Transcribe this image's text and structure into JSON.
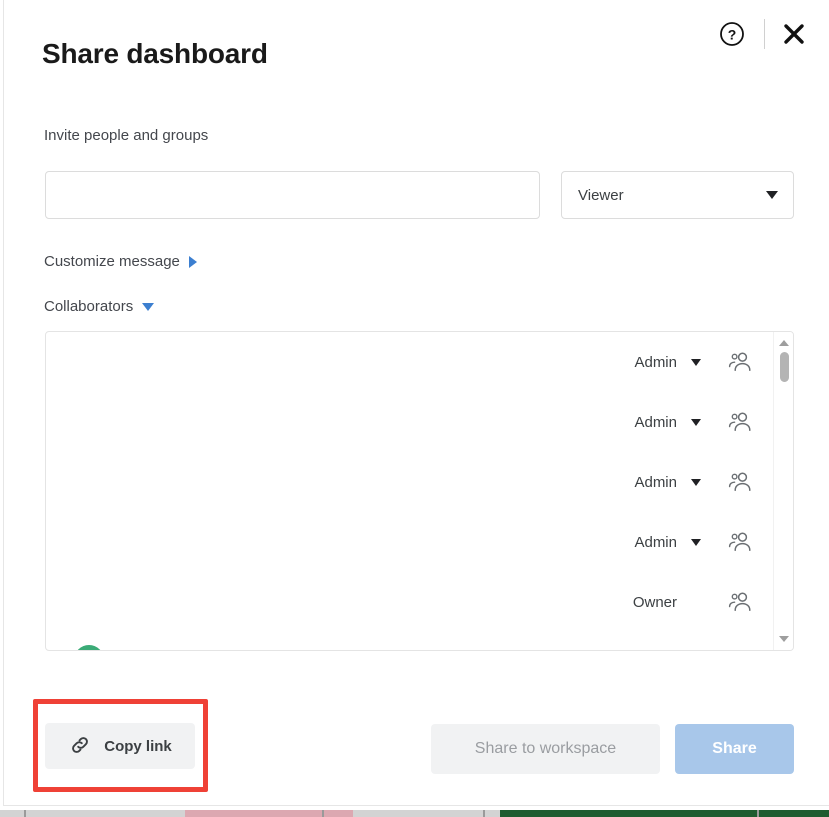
{
  "modal": {
    "title": "Share dashboard",
    "header_icons": {
      "help": "help-circle-icon",
      "close": "close-x-icon"
    }
  },
  "invite": {
    "label": "Invite people and groups",
    "input_value": "",
    "input_placeholder": "",
    "role": {
      "selected": "Viewer",
      "caret": "chevron-down-icon"
    }
  },
  "disclosures": {
    "customize_message": {
      "label": "Customize message",
      "state": "collapsed",
      "triangle": "triangle-right-icon"
    },
    "collaborators": {
      "label": "Collaborators",
      "state": "expanded",
      "triangle": "triangle-down-icon"
    }
  },
  "collaborators_list": {
    "rows": [
      {
        "role": "Admin",
        "has_role_dropdown": true,
        "icon": "people-icon"
      },
      {
        "role": "Admin",
        "has_role_dropdown": true,
        "icon": "people-icon"
      },
      {
        "role": "Admin",
        "has_role_dropdown": true,
        "icon": "people-icon"
      },
      {
        "role": "Admin",
        "has_role_dropdown": true,
        "icon": "people-icon"
      },
      {
        "role": "Owner",
        "has_role_dropdown": false,
        "icon": "people-icon"
      }
    ],
    "scrollbar": {
      "up_arrow": "scroll-up-arrow-icon",
      "down_arrow": "scroll-down-arrow-icon",
      "thumb_position": "top"
    },
    "partial_avatar_color": "#3bab77"
  },
  "footer": {
    "copy_link": {
      "label": "Copy link",
      "icon": "link-chain-icon",
      "highlighted": true,
      "highlight_color": "#ef4136"
    },
    "share_to_workspace": {
      "label": "Share to workspace",
      "enabled": false
    },
    "share": {
      "label": "Share",
      "enabled": false,
      "color": "#a8c7ea"
    }
  },
  "background": {
    "grey_bar_color": "#d3d3d3",
    "pink_bar_color": "#dca8b1",
    "green_bar_color": "#1e5c30"
  }
}
